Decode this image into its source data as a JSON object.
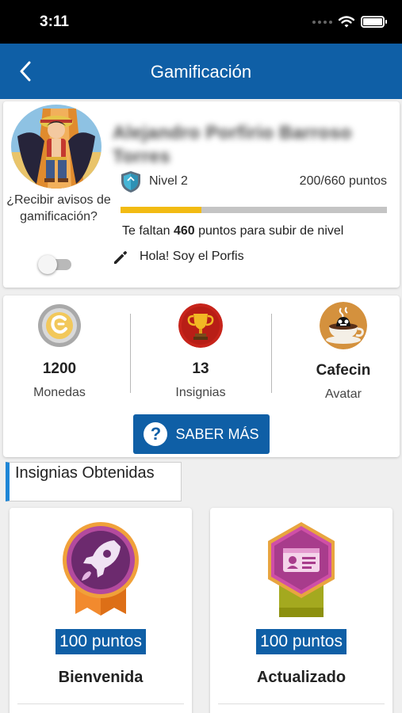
{
  "status_bar": {
    "time": "3:11"
  },
  "app_bar": {
    "title": "Gamificación"
  },
  "profile": {
    "name": "Alejandro Porfirio Barroso Torres",
    "notifications_label": "¿Recibir avisos de gamificación?",
    "notifications_enabled": false,
    "level": "Nivel 2",
    "points": "200/660 puntos",
    "progress_fraction": 0.303,
    "remaining_prefix": "Te faltan",
    "remaining_value": "460",
    "remaining_suffix": "puntos para subir de nivel",
    "status_message": "Hola! Soy el Porfis"
  },
  "stats": {
    "coins": {
      "value": "1200",
      "label": "Monedas",
      "icon": "coin-icon"
    },
    "badges": {
      "value": "13",
      "label": "Insignias",
      "icon": "trophy-icon"
    },
    "avatar": {
      "value": "Cafecin",
      "label": "Avatar",
      "icon": "coffee-avatar-icon"
    },
    "more_button": "SABER MÁS"
  },
  "section_title": "Insignias Obtenidas",
  "badges": [
    {
      "points": "100 puntos",
      "name": "Bienvenida",
      "icon": "rocket-badge-icon"
    },
    {
      "points": "100 puntos",
      "name": "Actualizado",
      "icon": "id-card-badge-icon"
    }
  ],
  "colors": {
    "primary": "#0f5fa6",
    "progress": "#f2bb13",
    "section_accent": "#1f86d6"
  }
}
